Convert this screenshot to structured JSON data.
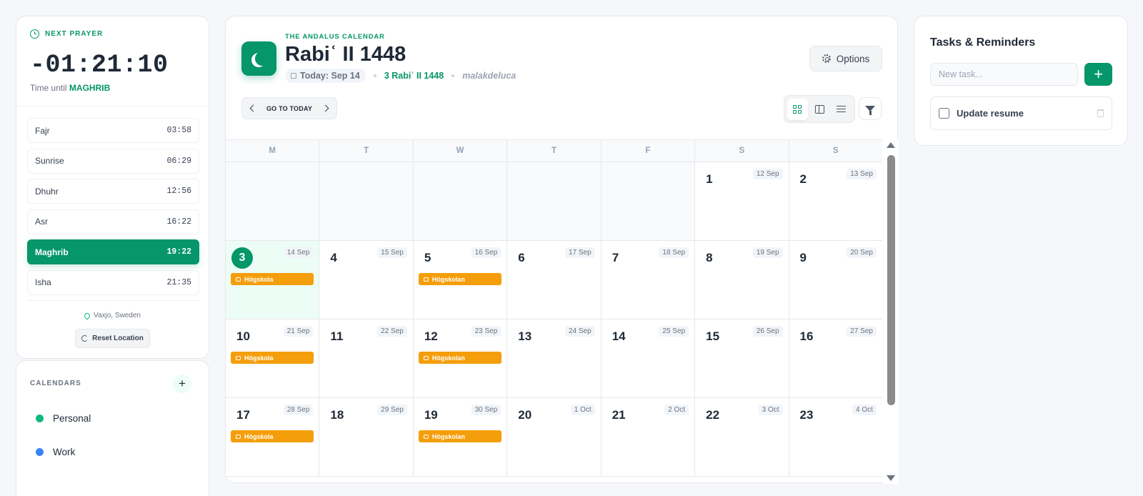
{
  "next_prayer": {
    "label": "NEXT PRAYER",
    "countdown": "-01:21:10",
    "until_prefix": "Time until",
    "until_name": "MAGHRIB"
  },
  "prayers": [
    {
      "name": "Fajr",
      "time": "03:58",
      "active": false
    },
    {
      "name": "Sunrise",
      "time": "06:29",
      "active": false
    },
    {
      "name": "Dhuhr",
      "time": "12:56",
      "active": false
    },
    {
      "name": "Asr",
      "time": "16:22",
      "active": false
    },
    {
      "name": "Maghrib",
      "time": "19:22",
      "active": true
    },
    {
      "name": "Isha",
      "time": "21:35",
      "active": false
    }
  ],
  "location": {
    "name": "Vaxjo, Sweden",
    "reset_label": "Reset Location"
  },
  "calendars": {
    "title": "CALENDARS",
    "add_label": "+",
    "items": [
      {
        "name": "Personal",
        "color": "#10b981"
      },
      {
        "name": "Work",
        "color": "#3b82f6"
      }
    ]
  },
  "header": {
    "brand": "THE ANDALUS CALENDAR",
    "month_title": "Rabiʿ II 1448",
    "today_label": "Today: Sep 14",
    "hijri_date": "3 Rabiʿ II 1448",
    "username": "malakdeluca",
    "options_label": "Options",
    "goto_today_label": "GO TO TODAY"
  },
  "weekdays": [
    "M",
    "T",
    "W",
    "T",
    "F",
    "S",
    "S"
  ],
  "weeks": [
    [
      {
        "empty": true
      },
      {
        "empty": true
      },
      {
        "empty": true
      },
      {
        "empty": true
      },
      {
        "empty": true
      },
      {
        "day": "1",
        "greg": "12 Sep"
      },
      {
        "day": "2",
        "greg": "13 Sep"
      }
    ],
    [
      {
        "day": "3",
        "greg": "14 Sep",
        "today": true,
        "event": "Högskola"
      },
      {
        "day": "4",
        "greg": "15 Sep"
      },
      {
        "day": "5",
        "greg": "16 Sep",
        "event": "Högskolan"
      },
      {
        "day": "6",
        "greg": "17 Sep"
      },
      {
        "day": "7",
        "greg": "18 Sep"
      },
      {
        "day": "8",
        "greg": "19 Sep"
      },
      {
        "day": "9",
        "greg": "20 Sep"
      }
    ],
    [
      {
        "day": "10",
        "greg": "21 Sep",
        "event": "Högskola"
      },
      {
        "day": "11",
        "greg": "22 Sep"
      },
      {
        "day": "12",
        "greg": "23 Sep",
        "event": "Högskolan"
      },
      {
        "day": "13",
        "greg": "24 Sep"
      },
      {
        "day": "14",
        "greg": "25 Sep"
      },
      {
        "day": "15",
        "greg": "26 Sep"
      },
      {
        "day": "16",
        "greg": "27 Sep"
      }
    ],
    [
      {
        "day": "17",
        "greg": "28 Sep",
        "event": "Högskola"
      },
      {
        "day": "18",
        "greg": "29 Sep"
      },
      {
        "day": "19",
        "greg": "30 Sep",
        "event": "Högskolan"
      },
      {
        "day": "20",
        "greg": "1 Oct"
      },
      {
        "day": "21",
        "greg": "2 Oct"
      },
      {
        "day": "22",
        "greg": "3 Oct"
      },
      {
        "day": "23",
        "greg": "4 Oct"
      }
    ]
  ],
  "tasks": {
    "title": "Tasks & Reminders",
    "input_placeholder": "New task...",
    "add_label": "+",
    "items": [
      {
        "label": "Update resume",
        "done": false
      }
    ]
  },
  "colors": {
    "accent": "#059669",
    "event": "#f59e0b",
    "today_bg": "#ecfdf5"
  }
}
